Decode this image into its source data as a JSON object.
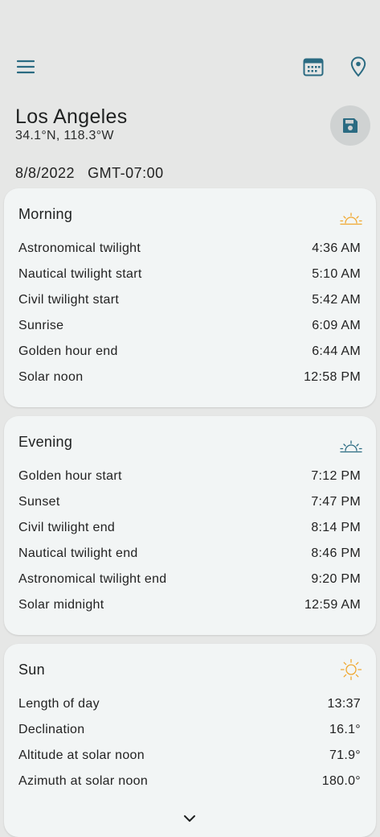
{
  "header": {
    "menu_icon": "menu-icon",
    "calendar_icon": "calendar-icon",
    "location_icon": "location-pin-icon",
    "accent": "#2b6b82"
  },
  "location": {
    "city": "Los Angeles",
    "coords": "34.1°N, 118.3°W",
    "save_icon": "save-icon"
  },
  "date": {
    "date": "8/8/2022",
    "timezone": "GMT-07:00"
  },
  "morning": {
    "title": "Morning",
    "icon": "sunrise-icon",
    "rows": [
      {
        "label": "Astronomical twilight",
        "value": "4:36 AM"
      },
      {
        "label": "Nautical twilight start",
        "value": "5:10 AM"
      },
      {
        "label": "Civil twilight start",
        "value": "5:42 AM"
      },
      {
        "label": "Sunrise",
        "value": "6:09 AM"
      },
      {
        "label": "Golden hour end",
        "value": "6:44 AM"
      },
      {
        "label": "Solar noon",
        "value": "12:58 PM"
      }
    ]
  },
  "evening": {
    "title": "Evening",
    "icon": "sunset-icon",
    "rows": [
      {
        "label": "Golden hour start",
        "value": "7:12 PM"
      },
      {
        "label": "Sunset",
        "value": "7:47 PM"
      },
      {
        "label": "Civil twilight end",
        "value": "8:14 PM"
      },
      {
        "label": "Nautical twilight end",
        "value": "8:46 PM"
      },
      {
        "label": "Astronomical twilight end",
        "value": "9:20 PM"
      },
      {
        "label": "Solar midnight",
        "value": "12:59 AM"
      }
    ]
  },
  "sun": {
    "title": "Sun",
    "icon": "sun-icon",
    "rows": [
      {
        "label": "Length of day",
        "value": "13:37"
      },
      {
        "label": "Declination",
        "value": "16.1°"
      },
      {
        "label": "Altitude at solar noon",
        "value": "71.9°"
      },
      {
        "label": "Azimuth at solar noon",
        "value": "180.0°"
      }
    ],
    "expand_icon": "chevron-down-icon"
  },
  "colors": {
    "sun_orange": "#f0a830",
    "sunset_blue": "#2b6b82",
    "card_bg": "#f2f5f5",
    "page_bg": "#e6e7e6"
  }
}
